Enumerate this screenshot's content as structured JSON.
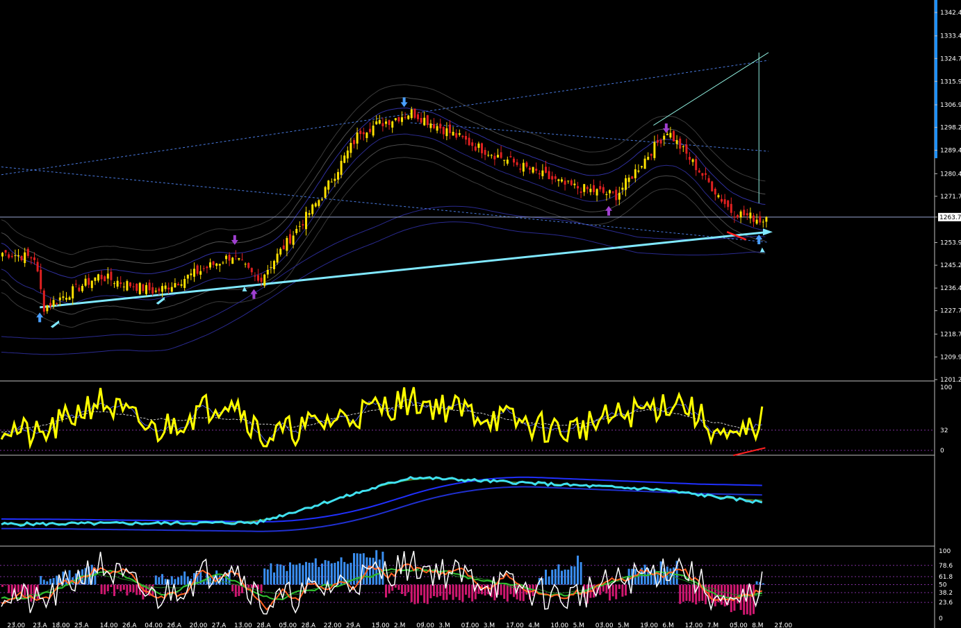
{
  "chart_data": {
    "type": "line",
    "subtype": "candlestick-with-indicators",
    "title": "",
    "xlabel": "",
    "ylabel": "",
    "colors": {
      "background": "#000000",
      "bull": "#ffe000",
      "bear": "#e02020",
      "trendline": "#80e8ff",
      "stoch": "#ffff00",
      "ma_fast": "#40e0f0",
      "ma_slow": "#2030ff",
      "hist_pos": "#3a8ef0",
      "hist_neg": "#d01870",
      "grid_dotted": "#8030a0",
      "right_accent": "#1e90ff"
    },
    "main_panel": {
      "ylim": [
        1201.2,
        1342.4
      ],
      "y_ticks": [
        "1342.4",
        "1333.4",
        "1324.7",
        "1315.9",
        "1306.9",
        "1298.2",
        "1289.4",
        "1280.4",
        "1271.7",
        "1263.7",
        "1253.9",
        "1245.2",
        "1236.4",
        "1227.7",
        "1218.7",
        "1209.9",
        "1201.2"
      ],
      "current_price": "1263.7",
      "num_bars": 240,
      "candles_close_by_segment": [
        {
          "from_bar": 0,
          "to_bar": 10,
          "close_start": 1250,
          "close_end": 1248
        },
        {
          "from_bar": 10,
          "to_bar": 13,
          "close_start": 1248,
          "close_end": 1229
        },
        {
          "from_bar": 13,
          "to_bar": 30,
          "close_start": 1229,
          "close_end": 1241
        },
        {
          "from_bar": 30,
          "to_bar": 48,
          "close_start": 1241,
          "close_end": 1235
        },
        {
          "from_bar": 48,
          "to_bar": 72,
          "close_start": 1235,
          "close_end": 1249
        },
        {
          "from_bar": 72,
          "to_bar": 80,
          "close_start": 1249,
          "close_end": 1239
        },
        {
          "from_bar": 80,
          "to_bar": 100,
          "close_start": 1239,
          "close_end": 1272
        },
        {
          "from_bar": 100,
          "to_bar": 112,
          "close_start": 1272,
          "close_end": 1297
        },
        {
          "from_bar": 112,
          "to_bar": 128,
          "close_start": 1297,
          "close_end": 1304
        },
        {
          "from_bar": 128,
          "to_bar": 148,
          "close_start": 1304,
          "close_end": 1291
        },
        {
          "from_bar": 148,
          "to_bar": 176,
          "close_start": 1291,
          "close_end": 1276
        },
        {
          "from_bar": 176,
          "to_bar": 192,
          "close_start": 1276,
          "close_end": 1272
        },
        {
          "from_bar": 192,
          "to_bar": 208,
          "close_start": 1272,
          "close_end": 1297
        },
        {
          "from_bar": 208,
          "to_bar": 228,
          "close_start": 1297,
          "close_end": 1266
        },
        {
          "from_bar": 228,
          "to_bar": 239,
          "close_start": 1266,
          "close_end": 1262
        }
      ],
      "trendline_main": {
        "from": {
          "bar": 12,
          "price": 1229
        },
        "to": {
          "bar": 240,
          "price": 1258
        }
      },
      "channel_lines": [
        {
          "from": {
            "bar": 0,
            "price": 1280
          },
          "to": {
            "bar": 240,
            "price": 1324
          }
        },
        {
          "from": {
            "bar": 128,
            "price": 1300
          },
          "to": {
            "bar": 240,
            "price": 1289
          }
        },
        {
          "from": {
            "bar": 0,
            "price": 1283
          },
          "to": {
            "bar": 240,
            "price": 1254
          }
        }
      ],
      "horizontal_line_price": 1263.7,
      "projection_lines": [
        {
          "from": {
            "bar": 204,
            "price": 1299
          },
          "to": {
            "bar": 240,
            "price": 1327
          }
        },
        {
          "from": {
            "bar": 237,
            "price": 1269
          },
          "to": {
            "bar": 237,
            "price": 1327
          }
        }
      ]
    },
    "stochastic_panel": {
      "ylim": [
        0,
        100
      ],
      "y_ticks": [
        "100",
        "32",
        "0"
      ],
      "levels": [
        32,
        0
      ],
      "k_by_segment": [
        {
          "from_bar": 0,
          "to_bar": 12,
          "k_start": 40,
          "k_end": 20
        },
        {
          "from_bar": 12,
          "to_bar": 30,
          "k_start": 20,
          "k_end": 80
        },
        {
          "from_bar": 30,
          "to_bar": 48,
          "k_start": 80,
          "k_end": 30
        },
        {
          "from_bar": 48,
          "to_bar": 72,
          "k_start": 30,
          "k_end": 85
        },
        {
          "from_bar": 72,
          "to_bar": 82,
          "k_start": 85,
          "k_end": 20
        },
        {
          "from_bar": 82,
          "to_bar": 128,
          "k_start": 20,
          "k_end": 80
        },
        {
          "from_bar": 128,
          "to_bar": 176,
          "k_start": 80,
          "k_end": 30
        },
        {
          "from_bar": 176,
          "to_bar": 212,
          "k_start": 30,
          "k_end": 80
        },
        {
          "from_bar": 212,
          "to_bar": 228,
          "k_start": 80,
          "k_end": 10
        },
        {
          "from_bar": 228,
          "to_bar": 239,
          "k_start": 10,
          "k_end": 50
        }
      ]
    },
    "ma_panel": {
      "fast_ma_by_segment": [
        {
          "from_bar": 0,
          "to_bar": 80,
          "v_start": 1238,
          "v_end": 1240
        },
        {
          "from_bar": 80,
          "to_bar": 128,
          "v_start": 1240,
          "v_end": 1297
        },
        {
          "from_bar": 128,
          "to_bar": 204,
          "v_start": 1297,
          "v_end": 1282
        },
        {
          "from_bar": 204,
          "to_bar": 239,
          "v_start": 1282,
          "v_end": 1265
        }
      ],
      "slow_ma_by_segment": [
        {
          "from_bar": 0,
          "to_bar": 100,
          "v_start": 1245,
          "v_end": 1240
        },
        {
          "from_bar": 100,
          "to_bar": 148,
          "v_start": 1240,
          "v_end": 1300
        },
        {
          "from_bar": 148,
          "to_bar": 239,
          "v_start": 1300,
          "v_end": 1285
        }
      ]
    },
    "oscillator_panel": {
      "ylim": [
        0,
        100
      ],
      "y_ticks": [
        "100",
        "78.6",
        "61.8",
        "50",
        "38.2",
        "23.6",
        "0"
      ],
      "histogram_by_segment": [
        {
          "from_bar": 0,
          "to_bar": 12,
          "v_start": -5,
          "v_end": -25
        },
        {
          "from_bar": 12,
          "to_bar": 30,
          "v_start": 5,
          "v_end": 25
        },
        {
          "from_bar": 30,
          "to_bar": 48,
          "v_start": -5,
          "v_end": -20
        },
        {
          "from_bar": 48,
          "to_bar": 72,
          "v_start": 10,
          "v_end": 15
        },
        {
          "from_bar": 72,
          "to_bar": 82,
          "v_start": -10,
          "v_end": -5
        },
        {
          "from_bar": 82,
          "to_bar": 120,
          "v_start": 20,
          "v_end": 40
        },
        {
          "from_bar": 120,
          "to_bar": 128,
          "v_start": -10,
          "v_end": -10
        },
        {
          "from_bar": 128,
          "to_bar": 168,
          "v_start": -20,
          "v_end": -15
        },
        {
          "from_bar": 168,
          "to_bar": 182,
          "v_start": 10,
          "v_end": 35
        },
        {
          "from_bar": 182,
          "to_bar": 196,
          "v_start": -20,
          "v_end": -10
        },
        {
          "from_bar": 196,
          "to_bar": 212,
          "v_start": 15,
          "v_end": 30
        },
        {
          "from_bar": 212,
          "to_bar": 236,
          "v_start": -20,
          "v_end": -35
        },
        {
          "from_bar": 236,
          "to_bar": 239,
          "v_start": 5,
          "v_end": 5
        }
      ]
    },
    "x_ticks": [
      {
        "bar": 4,
        "label": "23.00"
      },
      {
        "bar": 12,
        "label": "23.A"
      },
      {
        "bar": 18,
        "label": "18.00"
      },
      {
        "bar": 25,
        "label": "25.A"
      },
      {
        "bar": 33,
        "label": "14.00"
      },
      {
        "bar": 40,
        "label": "26.A"
      },
      {
        "bar": 47,
        "label": "04.00"
      },
      {
        "bar": 54,
        "label": "26.A"
      },
      {
        "bar": 61,
        "label": "20.00"
      },
      {
        "bar": 68,
        "label": "27.A"
      },
      {
        "bar": 75,
        "label": "13.00"
      },
      {
        "bar": 82,
        "label": "28.A"
      },
      {
        "bar": 89,
        "label": "05.00"
      },
      {
        "bar": 96,
        "label": "28.A"
      },
      {
        "bar": 103,
        "label": "22.00"
      },
      {
        "bar": 110,
        "label": "29.A"
      },
      {
        "bar": 118,
        "label": "15.00"
      },
      {
        "bar": 125,
        "label": "2.M"
      },
      {
        "bar": 132,
        "label": "09.00"
      },
      {
        "bar": 139,
        "label": "3.M"
      },
      {
        "bar": 146,
        "label": "01.00"
      },
      {
        "bar": 153,
        "label": "3.M"
      },
      {
        "bar": 160,
        "label": "17.00"
      },
      {
        "bar": 167,
        "label": "4.M"
      },
      {
        "bar": 174,
        "label": "10.00"
      },
      {
        "bar": 181,
        "label": "5.M"
      },
      {
        "bar": 188,
        "label": "03.00"
      },
      {
        "bar": 195,
        "label": "5.M"
      },
      {
        "bar": 202,
        "label": "19.00"
      },
      {
        "bar": 209,
        "label": "6.M"
      },
      {
        "bar": 216,
        "label": "12.00"
      },
      {
        "bar": 223,
        "label": "7.M"
      },
      {
        "bar": 230,
        "label": "05.00"
      },
      {
        "bar": 237,
        "label": "8.M"
      },
      {
        "bar": 244,
        "label": "21.00"
      }
    ]
  }
}
